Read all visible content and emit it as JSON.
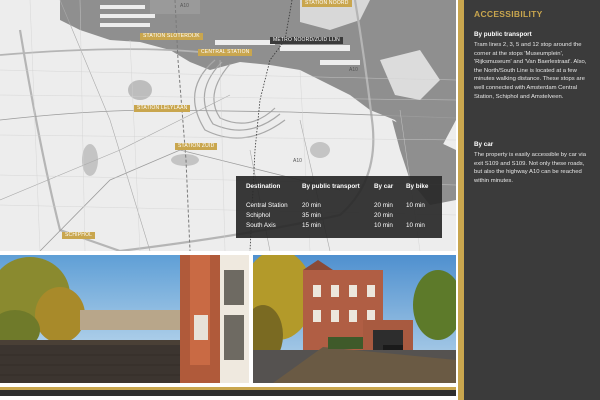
{
  "map": {
    "labels": {
      "sloterdijk": "STATION SLOTERDIJK",
      "central": "CENTRAL STATION",
      "noord": "STATION NOORD",
      "metro": "METRO NOORD/ZUID LIJN",
      "lelylaan": "STATION LELYLAAN",
      "zuid": "STATION ZUID",
      "schiphol": "SCHIPHOL"
    },
    "roads": {
      "a10_top": "A10",
      "a10_right": "A10",
      "a10_bottom": "A10"
    }
  },
  "table": {
    "headers": [
      "Destination",
      "By public transport",
      "By car",
      "By bike"
    ],
    "rows": [
      [
        "Central Station",
        "20 min",
        "20 min",
        "10 min"
      ],
      [
        "Schiphol",
        "35 min",
        "20 min",
        ""
      ],
      [
        "South Axis",
        "15 min",
        "10 min",
        "10 min"
      ]
    ]
  },
  "sidebar": {
    "title": "ACCESSIBILITY",
    "sections": [
      {
        "heading": "By public transport",
        "text": "Tram lines 2, 3, 5 and 12 stop around the corner at the stops 'Museumplein', 'Rijksmuseum' and 'Van Baerlestraat'. Also, the North/South Line is located at a few minutes walking distance. These stops are well connected with Amsterdam Central Station, Schiphol and Amstelveen."
      },
      {
        "heading": "By car",
        "text": "The property is easily accessible by car via exit S109 and S109. Not only these roads, but also the highway A10 can be reached within minutes."
      }
    ]
  },
  "colors": {
    "accent": "#c9a64e",
    "dark": "#3b3b3b",
    "water": "#8f8f8f"
  }
}
